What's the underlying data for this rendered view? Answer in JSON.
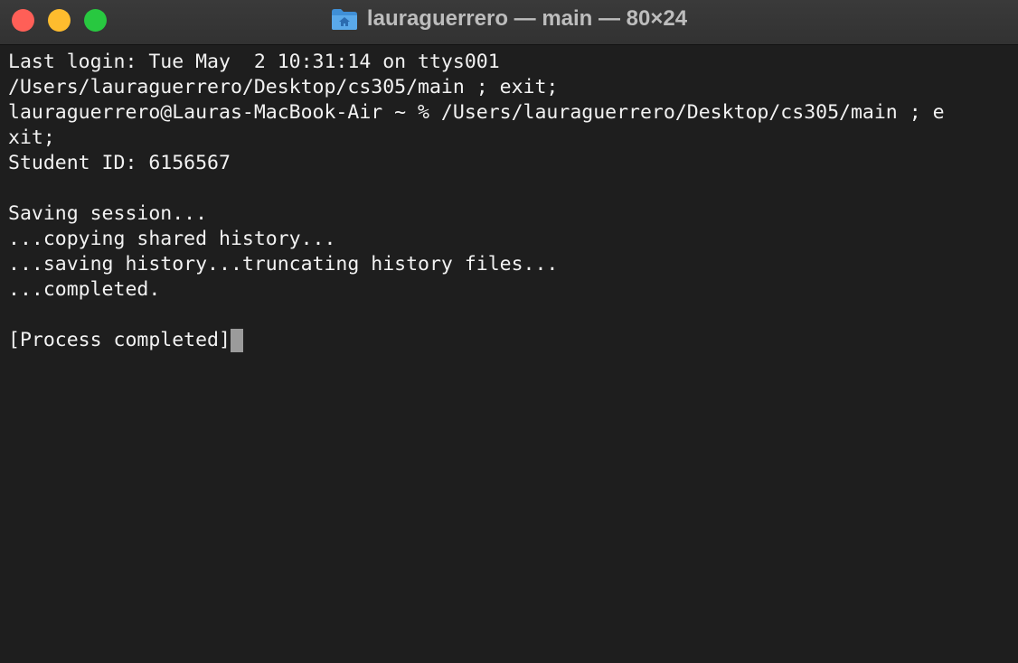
{
  "window": {
    "title": "lauraguerrero — main — 80×24",
    "title_icon": "home-folder-icon"
  },
  "terminal": {
    "lines": [
      "Last login: Tue May  2 10:31:14 on ttys001",
      "/Users/lauraguerrero/Desktop/cs305/main ; exit;",
      "lauraguerrero@Lauras-MacBook-Air ~ % /Users/lauraguerrero/Desktop/cs305/main ; e",
      "xit;",
      "Student ID: 6156567",
      "",
      "Saving session...",
      "...copying shared history...",
      "...saving history...truncating history files...",
      "...completed.",
      "",
      "[Process completed]"
    ]
  },
  "colors": {
    "background": "#1e1e1e",
    "text": "#f2f2f2",
    "cursor": "#9b9b9b",
    "close": "#ff5f57",
    "minimize": "#febc2e",
    "zoom": "#28c840"
  }
}
